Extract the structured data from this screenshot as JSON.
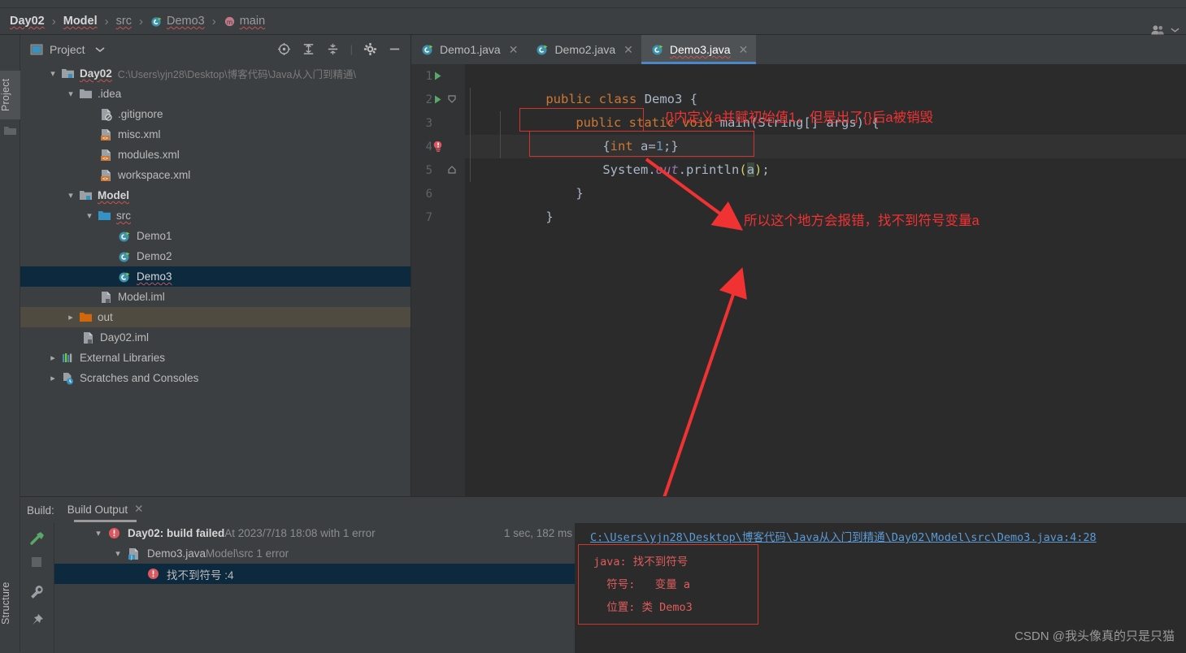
{
  "breadcrumb": {
    "items": [
      {
        "label": "Day02",
        "style": "bold",
        "icon": null
      },
      {
        "label": "Model",
        "style": "bold",
        "icon": null
      },
      {
        "label": "src",
        "style": "dim",
        "icon": null
      },
      {
        "label": "Demo3",
        "style": "dim",
        "icon": "java-class-icon"
      },
      {
        "label": "main",
        "style": "dim",
        "icon": "method-icon"
      }
    ],
    "separator": "›",
    "account_icon": "account-icon",
    "account_chevron": "chevron-down-icon"
  },
  "left_strip": {
    "project_label": "Project",
    "structure_label": "Structure",
    "folder_icon": "folder-icon",
    "build_tool_icons": [
      "hammer-icon",
      "stop-icon",
      "wrench-icon",
      "pin-icon"
    ]
  },
  "project_panel": {
    "title": "Project",
    "title_icon": "project-icon",
    "dropdown_icon": "chevron-down-icon",
    "toolbar_icons": [
      "locate-icon",
      "expand-all-icon",
      "collapse-all-icon",
      "settings-gear-icon",
      "hide-minus-icon"
    ],
    "tree": [
      {
        "depth": 0,
        "arrow": "expanded",
        "icon": "module-folder-icon",
        "label": "Day02",
        "bold": true,
        "path": "C:\\Users\\yjn28\\Desktop\\博客代码\\Java从入门到精通\\",
        "state": "normal"
      },
      {
        "depth": 1,
        "arrow": "expanded",
        "icon": "folder-icon",
        "label": ".idea",
        "bold": false,
        "path": "",
        "state": "normal"
      },
      {
        "depth": 2,
        "arrow": "none",
        "icon": "gitignore-file-icon",
        "label": ".gitignore",
        "bold": false,
        "path": "",
        "state": "normal"
      },
      {
        "depth": 2,
        "arrow": "none",
        "icon": "xml-file-icon",
        "label": "misc.xml",
        "bold": false,
        "path": "",
        "state": "normal"
      },
      {
        "depth": 2,
        "arrow": "none",
        "icon": "xml-file-icon",
        "label": "modules.xml",
        "bold": false,
        "path": "",
        "state": "normal"
      },
      {
        "depth": 2,
        "arrow": "none",
        "icon": "xml-file-icon",
        "label": "workspace.xml",
        "bold": false,
        "path": "",
        "state": "normal"
      },
      {
        "depth": 1,
        "arrow": "expanded",
        "icon": "module-folder-icon",
        "label": "Model",
        "bold": true,
        "path": "",
        "state": "normal"
      },
      {
        "depth": 2,
        "arrow": "expanded",
        "icon": "source-folder-icon",
        "label": "src",
        "bold": false,
        "path": "",
        "state": "normal"
      },
      {
        "depth": 3,
        "arrow": "none",
        "icon": "java-class-icon",
        "label": "Demo1",
        "bold": false,
        "path": "",
        "state": "normal"
      },
      {
        "depth": 3,
        "arrow": "none",
        "icon": "java-class-icon",
        "label": "Demo2",
        "bold": false,
        "path": "",
        "state": "normal"
      },
      {
        "depth": 3,
        "arrow": "none",
        "icon": "java-class-icon",
        "label": "Demo3",
        "bold": false,
        "path": "",
        "state": "selected"
      },
      {
        "depth": 2,
        "arrow": "none",
        "icon": "iml-file-icon",
        "label": "Model.iml",
        "bold": false,
        "path": "",
        "state": "normal"
      },
      {
        "depth": 1,
        "arrow": "collapsed",
        "icon": "out-folder-icon",
        "label": "out",
        "bold": false,
        "path": "",
        "state": "highlight"
      },
      {
        "depth": 1,
        "arrow": "none",
        "icon": "iml-file-icon",
        "label": "Day02.iml",
        "bold": false,
        "path": "",
        "state": "normal"
      },
      {
        "depth": 0,
        "arrow": "collapsed",
        "icon": "external-libraries-icon",
        "label": "External Libraries",
        "bold": false,
        "path": "",
        "state": "normal"
      },
      {
        "depth": 0,
        "arrow": "collapsed",
        "icon": "scratches-icon",
        "label": "Scratches and Consoles",
        "bold": false,
        "path": "",
        "state": "normal"
      }
    ]
  },
  "editor": {
    "tabs": [
      {
        "label": "Demo1.java",
        "icon": "java-class-icon",
        "active": false,
        "close_icon": "close-icon"
      },
      {
        "label": "Demo2.java",
        "icon": "java-class-icon",
        "active": false,
        "close_icon": "close-icon"
      },
      {
        "label": "Demo3.java",
        "icon": "java-class-icon",
        "active": true,
        "close_icon": "close-icon"
      }
    ],
    "lines": [
      {
        "num": "1",
        "gutter": "run-icon",
        "fold": ""
      },
      {
        "num": "2",
        "gutter": "run-icon",
        "fold": "fold-start-icon"
      },
      {
        "num": "3",
        "gutter": "",
        "fold": ""
      },
      {
        "num": "4",
        "gutter": "error-bulb-icon",
        "fold": ""
      },
      {
        "num": "5",
        "gutter": "",
        "fold": "fold-end-icon"
      },
      {
        "num": "6",
        "gutter": "",
        "fold": ""
      },
      {
        "num": "7",
        "gutter": "",
        "fold": ""
      }
    ],
    "code": {
      "line1": "public class Demo3 {",
      "line2": "public static void main(String[] args) {",
      "line3": "{int a=1;}",
      "line4": "System.out.println(a);",
      "line5": "}",
      "line6": "}"
    }
  },
  "annotations": {
    "note1": "{}内定义a并赋初始值1，但是出了{}后a被销毁",
    "note2": "所以这个地方会报错，找不到符号变量a"
  },
  "build_panel": {
    "label": "Build:",
    "tab_label": "Build Output",
    "tab_close_icon": "close-icon",
    "rows": [
      {
        "indent": 0,
        "arrow": "expanded",
        "icon": "error-icon",
        "bold_text": "Day02: build failed",
        "text": " At 2023/7/18 18:08 with 1 error",
        "time": "1 sec, 182 ms",
        "selected": false
      },
      {
        "indent": 1,
        "arrow": "expanded",
        "icon": "java-file-icon",
        "bold_text": "Demo3.java",
        "text": " Model\\src 1 error",
        "time": "",
        "selected": false
      },
      {
        "indent": 2,
        "arrow": "none",
        "icon": "error-icon",
        "bold_text": "",
        "text": "找不到符号 :4",
        "time": "",
        "selected": true
      }
    ],
    "output_link": "C:\\Users\\yjn28\\Desktop\\博客代码\\Java从入门到精通\\Day02\\Model\\src\\Demo3.java:4:28",
    "output_error_lines": [
      "java: 找不到符号",
      "  符号:   变量 a",
      "  位置: 类 Demo3"
    ]
  },
  "watermark": "CSDN @我头像真的只是只猫",
  "colors": {
    "accent_blue": "#4a88c7",
    "error_red": "#d0342c",
    "annotation_red": "#f03232",
    "link_blue": "#5b9bd5",
    "selection_blue": "#0d293e",
    "editor_bg": "#2b2b2b",
    "panel_bg": "#3c3f41"
  }
}
